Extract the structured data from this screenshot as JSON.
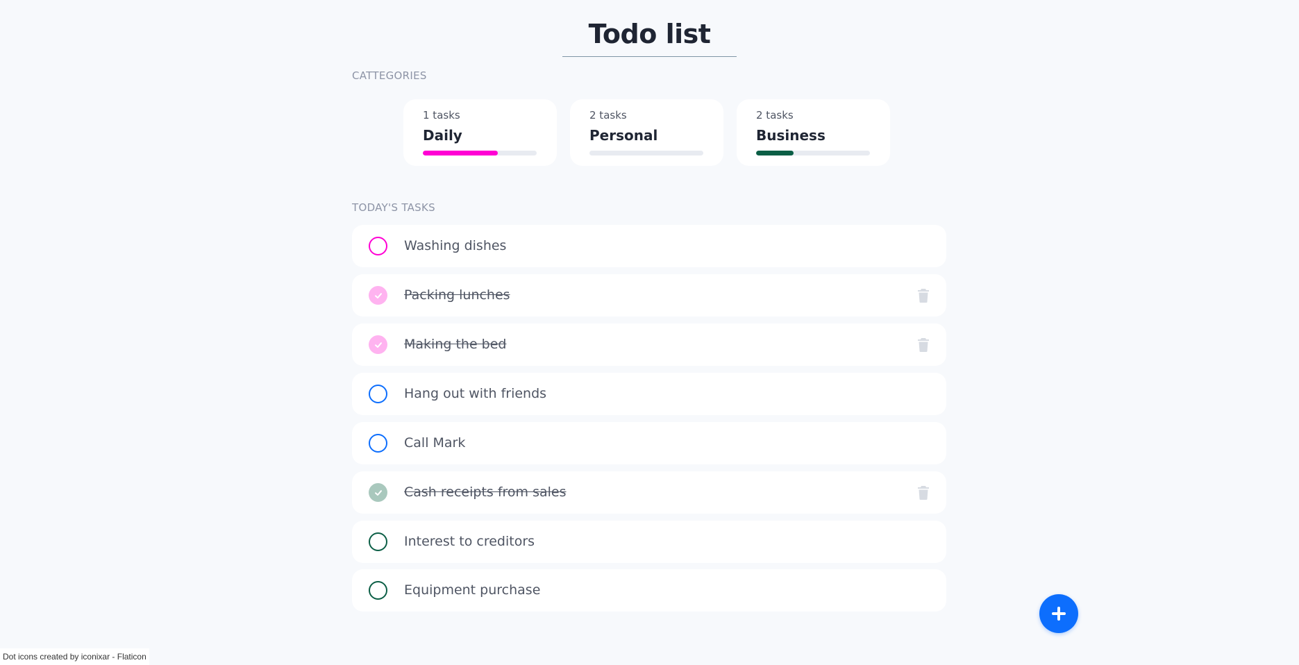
{
  "header": {
    "title": "Todo list"
  },
  "categories_label": "CATTEGORIES",
  "categories": [
    {
      "count": "1 tasks",
      "name": "Daily",
      "progress": 0.66,
      "color": "#ff00d4"
    },
    {
      "count": "2 tasks",
      "name": "Personal",
      "progress": 0.0,
      "color": "#0d6efd"
    },
    {
      "count": "2 tasks",
      "name": "Business",
      "progress": 0.33,
      "color": "#0b5e45"
    }
  ],
  "tasks_label": "TODAY'S TASKS",
  "tasks": [
    {
      "text": "Washing dishes",
      "done": false,
      "color": "#ff00d4"
    },
    {
      "text": "Packing lunches",
      "done": true,
      "color": "#ffb3f0"
    },
    {
      "text": "Making the bed",
      "done": true,
      "color": "#ffb3f0"
    },
    {
      "text": "Hang out with friends",
      "done": false,
      "color": "#0d6efd"
    },
    {
      "text": "Call Mark",
      "done": false,
      "color": "#0d6efd"
    },
    {
      "text": "Cash receipts from sales",
      "done": true,
      "color": "#a9c8bd"
    },
    {
      "text": "Interest to creditors",
      "done": false,
      "color": "#0b5e45"
    },
    {
      "text": "Equipment purchase",
      "done": false,
      "color": "#0b5e45"
    }
  ],
  "icons": {
    "check": "check-icon",
    "trash": "trash-icon",
    "add": "plus-icon"
  },
  "colors": {
    "trash": "#d7dbe2",
    "fab": "#0d6efd"
  },
  "attribution": "Dot icons created by iconixar - Flaticon"
}
